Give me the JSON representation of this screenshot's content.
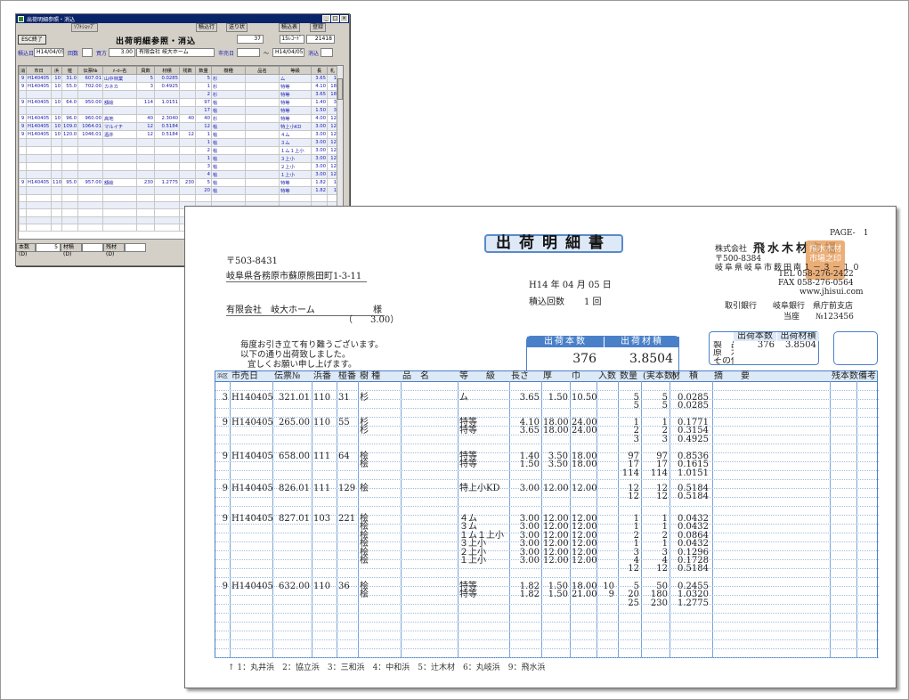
{
  "back_window": {
    "title": "出荷明細参照・消込",
    "toolbar": {
      "btn1": "ｿﾌﾄｼｮｯﾌﾟ",
      "btn2": "積込行",
      "btn3": "送り状",
      "btn4": "積込表",
      "btn5": "登録"
    },
    "esc_label": "ESC終了",
    "window_title": "出荷明細参照・消込",
    "page": {
      "a": "37",
      "b": "15ﾚｺｰﾄﾞ",
      "c": "21418"
    },
    "filters": {
      "load_date_label": "積込日",
      "load_date": "H14/04/05",
      "count_label": "回数",
      "buyer_label": "買方",
      "buyer_code": "3.00",
      "buyer_name": "有限会社 岐大ホーム",
      "market_date_label": "市売日",
      "range_sep": "～",
      "market_date": "H14/04/05",
      "clear_label": "消込"
    },
    "columns": [
      "消",
      "市日",
      "浜",
      "椪",
      "伝票№",
      "ﾒｰｶｰ名",
      "員数",
      "材積",
      "残数",
      "数量",
      "樹種",
      "品名",
      "等級",
      "長",
      "札"
    ],
    "rows": [
      [
        "9",
        "H140405",
        "10",
        "31.0",
        "607.01",
        "山中林業",
        "5",
        "0.0285",
        "",
        "5",
        "杉",
        "",
        "ム",
        "3.65",
        "1"
      ],
      [
        "9",
        "H140405",
        "10",
        "55.0",
        "702.00",
        "カネカ",
        "3",
        "0.4925",
        "",
        "1",
        "杉",
        "",
        "特等",
        "4.10",
        "18"
      ],
      [
        "",
        "",
        "",
        "",
        "",
        "",
        "",
        "",
        "",
        "2",
        "杉",
        "",
        "特等",
        "3.65",
        "18"
      ],
      [
        "9",
        "H140405",
        "10",
        "64.0",
        "950.00",
        "額絵",
        "114",
        "1.0151",
        "",
        "97",
        "桧",
        "",
        "特等",
        "1.40",
        "3"
      ],
      [
        "",
        "",
        "",
        "",
        "",
        "",
        "",
        "",
        "",
        "17",
        "桧",
        "",
        "特等",
        "1.50",
        "3"
      ],
      [
        "9",
        "H140405",
        "10",
        "96.0",
        "960.00",
        "高地",
        "40",
        "2.3040",
        "40",
        "40",
        "杉",
        "",
        "特等",
        "4.00",
        "12"
      ],
      [
        "9",
        "H140405",
        "10",
        "109.0",
        "1064.01",
        "マルイチ",
        "12",
        "0.5184",
        "",
        "12",
        "桧",
        "",
        "特上小KD",
        "3.00",
        "12"
      ],
      [
        "9",
        "H140405",
        "10",
        "120.0",
        "1046.01",
        "酒井",
        "12",
        "0.5184",
        "12",
        "1",
        "桧",
        "",
        "４ム",
        "3.00",
        "12"
      ],
      [
        "",
        "",
        "",
        "",
        "",
        "",
        "",
        "",
        "",
        "1",
        "桧",
        "",
        "３ム",
        "3.00",
        "12"
      ],
      [
        "",
        "",
        "",
        "",
        "",
        "",
        "",
        "",
        "",
        "2",
        "桧",
        "",
        "１ム１上小",
        "3.00",
        "12"
      ],
      [
        "",
        "",
        "",
        "",
        "",
        "",
        "",
        "",
        "",
        "1",
        "桧",
        "",
        "３上小",
        "3.00",
        "12"
      ],
      [
        "",
        "",
        "",
        "",
        "",
        "",
        "",
        "",
        "",
        "3",
        "桧",
        "",
        "２上小",
        "3.00",
        "12"
      ],
      [
        "",
        "",
        "",
        "",
        "",
        "",
        "",
        "",
        "",
        "4",
        "桧",
        "",
        "１上小",
        "3.00",
        "12"
      ],
      [
        "9",
        "H140405",
        "110",
        "95.0",
        "957.00",
        "額絵",
        "230",
        "1.2775",
        "230",
        "5",
        "桧",
        "",
        "特等",
        "1.82",
        "1"
      ],
      [
        "",
        "",
        "",
        "",
        "",
        "",
        "",
        "",
        "",
        "20",
        "桧",
        "",
        "特等",
        "1.82",
        "1"
      ],
      [
        "",
        "",
        "",
        "",
        "",
        "",
        "",
        "",
        "",
        "",
        "",
        "",
        "",
        "",
        ""
      ],
      [
        "",
        "",
        "",
        "",
        "",
        "",
        "",
        "",
        "",
        "",
        "",
        "",
        "",
        "",
        ""
      ],
      [
        "",
        "",
        "",
        "",
        "",
        "",
        "",
        "",
        "",
        "",
        "",
        "",
        "",
        "",
        ""
      ],
      [
        "",
        "",
        "",
        "",
        "",
        "",
        "",
        "",
        "",
        "",
        "",
        "",
        "",
        "",
        ""
      ],
      [
        "",
        "",
        "",
        "",
        "",
        "",
        "",
        "",
        "",
        "",
        "",
        "",
        "",
        "",
        ""
      ]
    ],
    "status": {
      "l1": "本数(D)",
      "v1": "5",
      "l2": "材積(D)",
      "v2": "",
      "l3": "残材(D)",
      "v3": ""
    }
  },
  "report": {
    "page": "PAGE-　1",
    "title": "出荷明細書",
    "to_zip": "〒503-8431",
    "to_address": "岐阜県各務原市蘇原熊田町1-3-11",
    "to_name": "有限会社　岐大ホーム",
    "honorific": "様",
    "to_code": "（　　3.00）",
    "date": "H14 年 04 月 05 日",
    "load_count_label": "積込回数",
    "load_count": "1 回",
    "company_prefix": "株式会社",
    "company": "飛水木材市場",
    "co_zip": "〒500-8384",
    "co_address": "岐阜県岐阜市薮田南１－３－１０",
    "co_tel": "TEL 058-276-2422",
    "co_fax": "FAX 058-276-0564",
    "co_web": "www.jhisui.com",
    "bank": "取引銀行　　岐阜銀行　県庁前支店",
    "account": "当座　　№123456",
    "seal_text": "飛水木材市場之印",
    "greeting1": "毎度お引き立て有り難うございます。",
    "greeting2": "以下の通り出荷致しました。",
    "greeting3": "宜しくお願い申し上げます。",
    "sum_count_label": "出荷本数",
    "sum_volume_label": "出荷材積",
    "sum_count": "376",
    "sum_volume": "3.8504",
    "rbox": {
      "h1": "出荷本数",
      "h2": "出荷材積",
      "r1": "製　品",
      "r1c": "376",
      "r1v": "3.8504",
      "r2": "原　木",
      "r3": "その他"
    },
    "headers": [
      "浜\n区",
      "市売日",
      "伝票№",
      "浜番",
      "椪番",
      "樹 種",
      "品　名",
      "等　　級",
      "長さ",
      "厚",
      "巾",
      "入数",
      "数量",
      "(実本数)",
      "材　積",
      "摘　　要",
      "残本数",
      "備考"
    ],
    "groups": [
      {
        "rows": [
          [
            "3",
            "H140405",
            "321.01",
            "110",
            "31",
            "杉",
            "",
            "ム",
            "3.65",
            "1.50",
            "10.50",
            "",
            "5",
            "5",
            "0.0285"
          ],
          [
            "",
            "",
            "",
            "",
            "",
            "",
            "",
            "",
            "",
            "",
            "",
            "",
            "5",
            "5",
            "0.0285"
          ]
        ]
      },
      {
        "rows": [
          [
            "9",
            "H140405",
            "265.00",
            "110",
            "55",
            "杉",
            "",
            "特等",
            "4.10",
            "18.00",
            "24.00",
            "",
            "1",
            "1",
            "0.1771"
          ],
          [
            "",
            "",
            "",
            "",
            "",
            "杉",
            "",
            "特等",
            "3.65",
            "18.00",
            "24.00",
            "",
            "2",
            "2",
            "0.3154"
          ],
          [
            "",
            "",
            "",
            "",
            "",
            "",
            "",
            "",
            "",
            "",
            "",
            "",
            "3",
            "3",
            "0.4925"
          ]
        ]
      },
      {
        "rows": [
          [
            "9",
            "H140405",
            "658.00",
            "111",
            "64",
            "桧",
            "",
            "特等",
            "1.40",
            "3.50",
            "18.00",
            "",
            "97",
            "97",
            "0.8536"
          ],
          [
            "",
            "",
            "",
            "",
            "",
            "桧",
            "",
            "特等",
            "1.50",
            "3.50",
            "18.00",
            "",
            "17",
            "17",
            "0.1615"
          ],
          [
            "",
            "",
            "",
            "",
            "",
            "",
            "",
            "",
            "",
            "",
            "",
            "",
            "114",
            "114",
            "1.0151"
          ]
        ]
      },
      {
        "rows": [
          [
            "9",
            "H140405",
            "826.01",
            "111",
            "129",
            "桧",
            "",
            "特上小KD",
            "3.00",
            "12.00",
            "12.00",
            "",
            "12",
            "12",
            "0.5184"
          ],
          [
            "",
            "",
            "",
            "",
            "",
            "",
            "",
            "",
            "",
            "",
            "",
            "",
            "12",
            "12",
            "0.5184"
          ]
        ]
      },
      {
        "rows": [
          [
            "9",
            "H140405",
            "827.01",
            "103",
            "221",
            "桧",
            "",
            "４ム",
            "3.00",
            "12.00",
            "12.00",
            "",
            "1",
            "1",
            "0.0432"
          ],
          [
            "",
            "",
            "",
            "",
            "",
            "桧",
            "",
            "３ム",
            "3.00",
            "12.00",
            "12.00",
            "",
            "1",
            "1",
            "0.0432"
          ],
          [
            "",
            "",
            "",
            "",
            "",
            "桧",
            "",
            "１ム１上小",
            "3.00",
            "12.00",
            "12.00",
            "",
            "2",
            "2",
            "0.0864"
          ],
          [
            "",
            "",
            "",
            "",
            "",
            "桧",
            "",
            "３上小",
            "3.00",
            "12.00",
            "12.00",
            "",
            "1",
            "1",
            "0.0432"
          ],
          [
            "",
            "",
            "",
            "",
            "",
            "桧",
            "",
            "２上小",
            "3.00",
            "12.00",
            "12.00",
            "",
            "3",
            "3",
            "0.1296"
          ],
          [
            "",
            "",
            "",
            "",
            "",
            "桧",
            "",
            "１上小",
            "3.00",
            "12.00",
            "12.00",
            "",
            "4",
            "4",
            "0.1728"
          ],
          [
            "",
            "",
            "",
            "",
            "",
            "",
            "",
            "",
            "",
            "",
            "",
            "",
            "12",
            "12",
            "0.5184"
          ]
        ]
      },
      {
        "rows": [
          [
            "9",
            "H140405",
            "632.00",
            "110",
            "36",
            "桧",
            "",
            "特等",
            "1.82",
            "1.50",
            "18.00",
            "10",
            "5",
            "50",
            "0.2455"
          ],
          [
            "",
            "",
            "",
            "",
            "",
            "桧",
            "",
            "特等",
            "1.82",
            "1.50",
            "21.00",
            "9",
            "20",
            "180",
            "1.0320"
          ],
          [
            "",
            "",
            "",
            "",
            "",
            "",
            "",
            "",
            "",
            "",
            "",
            "",
            "25",
            "230",
            "1.2775"
          ]
        ]
      }
    ],
    "footer": "1：丸井浜　2：協立浜　3：三和浜　4：中和浜　5：辻木材　6：丸岐浜　9：飛水浜"
  }
}
